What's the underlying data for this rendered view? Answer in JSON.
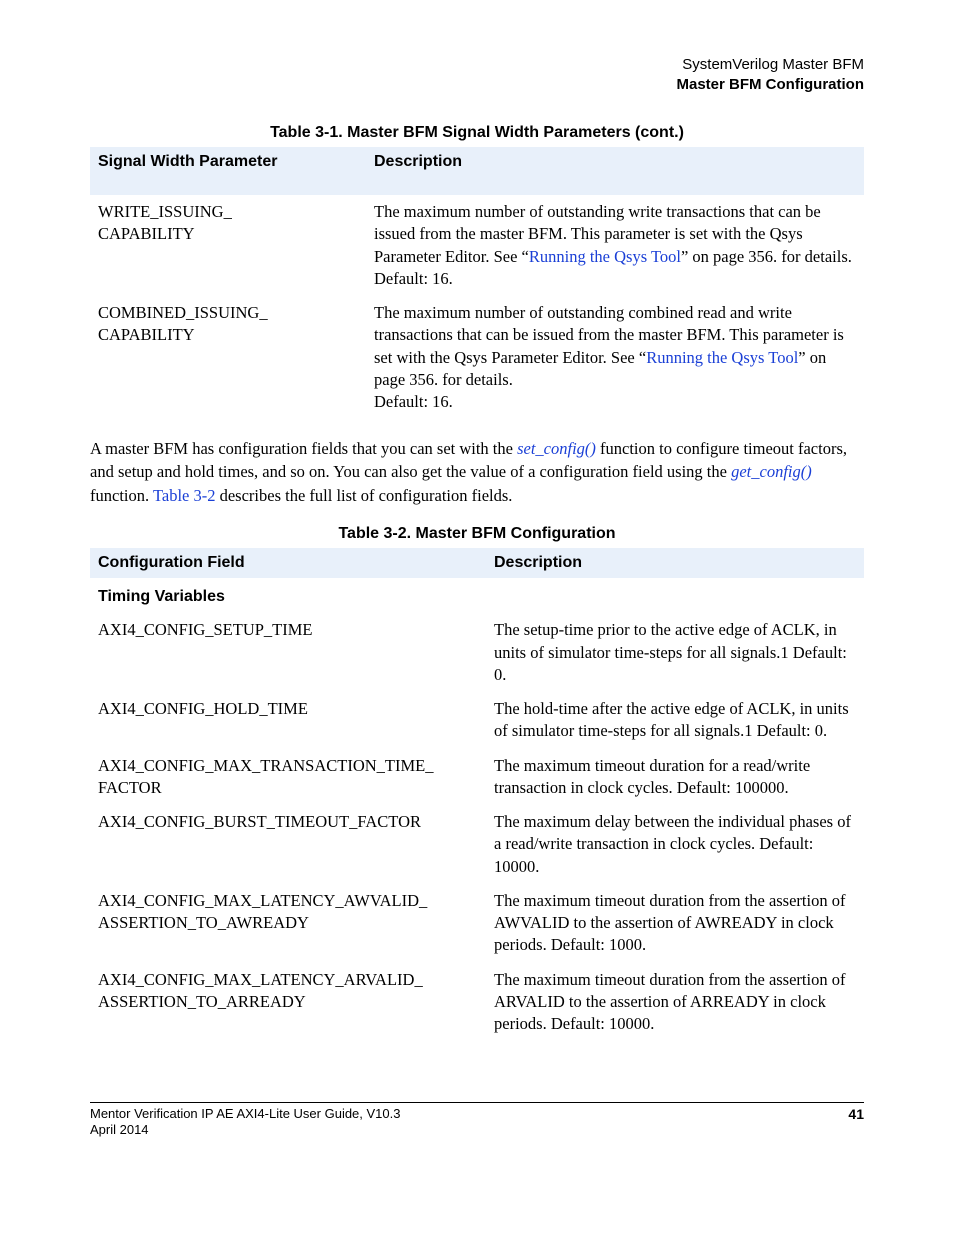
{
  "header": {
    "line1": "SystemVerilog Master BFM",
    "line2": "Master BFM Configuration"
  },
  "table31": {
    "caption": "Table 3-1. Master BFM Signal Width Parameters (cont.)",
    "hdr_param": "Signal Width Parameter",
    "hdr_desc": "Description",
    "rows": [
      {
        "param": "WRITE_ISSUING_\nCAPABILITY",
        "desc_pre": "The maximum number of outstanding write transactions that can be issued from the master BFM. This parameter is set with the Qsys Parameter Editor. See “",
        "link": "Running the Qsys Tool",
        "desc_mid": "” on page 356. for details.",
        "default": "Default: 16."
      },
      {
        "param": "COMBINED_ISSUING_\nCAPABILITY",
        "desc_pre": "The maximum number of outstanding combined read and write transactions that can be issued from the master BFM. This parameter is set with the Qsys Parameter Editor. See “",
        "link": "Running the Qsys Tool",
        "desc_mid": "” on page 356. for details.",
        "default": "Default: 16."
      }
    ]
  },
  "para": {
    "t1": "A master BFM has configuration fields that you can set with the ",
    "l1": "set_config()",
    "t2": " function to configure timeout factors, and setup and hold times, and so on. You can also get the value of a configuration field using the ",
    "l2": "get_config()",
    "t3": " function. ",
    "l3": "Table 3-2",
    "t4": " describes the full list of configuration fields."
  },
  "table32": {
    "caption": "Table 3-2. Master BFM Configuration",
    "hdr_cfg": "Configuration Field",
    "hdr_desc": "Description",
    "subhead": "Timing Variables",
    "rows": [
      {
        "cfg": "AXI4_CONFIG_SETUP_TIME",
        "desc": "The setup-time prior to the active edge of ACLK, in units of simulator time-steps for all signals.1 Default: 0."
      },
      {
        "cfg": "AXI4_CONFIG_HOLD_TIME",
        "desc": "The hold-time after the active edge of ACLK, in units of simulator time-steps for all signals.1 Default: 0."
      },
      {
        "cfg": "AXI4_CONFIG_MAX_TRANSACTION_TIME_\nFACTOR",
        "desc": "The maximum timeout duration for a read/write transaction in clock cycles. Default: 100000."
      },
      {
        "cfg": "AXI4_CONFIG_BURST_TIMEOUT_FACTOR",
        "desc": "The maximum delay between the individual phases of a read/write transaction in clock cycles. Default: 10000."
      },
      {
        "cfg": "AXI4_CONFIG_MAX_LATENCY_AWVALID_\nASSERTION_TO_AWREADY",
        "desc": "The maximum timeout duration from the assertion of AWVALID to the assertion of AWREADY in clock periods. Default: 1000."
      },
      {
        "cfg": "AXI4_CONFIG_MAX_LATENCY_ARVALID_\nASSERTION_TO_ARREADY",
        "desc": "The maximum timeout duration from the assertion of ARVALID to the assertion of ARREADY in clock periods. Default: 10000."
      }
    ]
  },
  "footer": {
    "title": "Mentor Verification IP AE AXI4-Lite User Guide, V10.3",
    "page": "41",
    "date": "April 2014"
  }
}
